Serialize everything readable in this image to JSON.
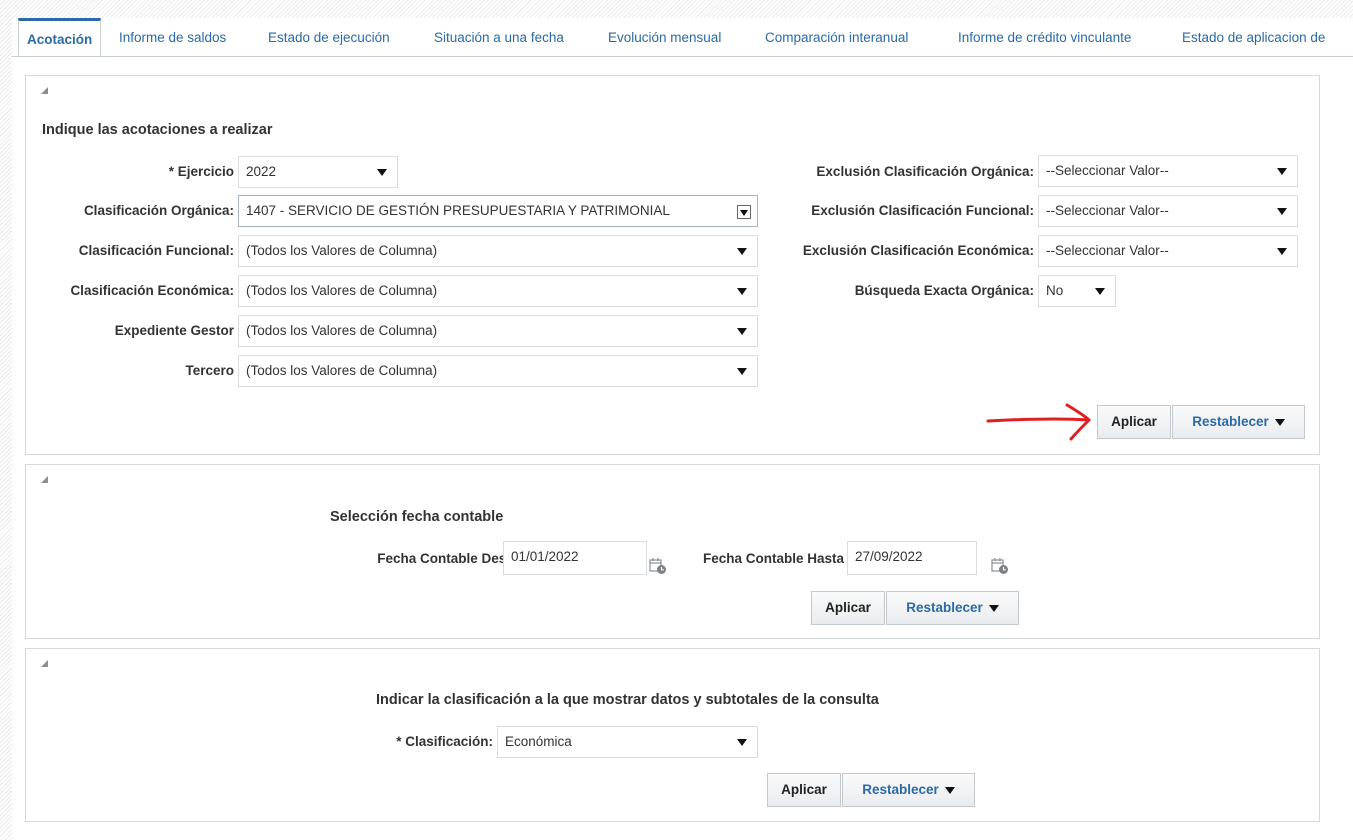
{
  "tabs": [
    {
      "label": "Acotación",
      "active": true
    },
    {
      "label": "Informe de saldos"
    },
    {
      "label": "Estado de ejecución"
    },
    {
      "label": "Situación a una fecha"
    },
    {
      "label": "Evolución mensual"
    },
    {
      "label": "Comparación interanual"
    },
    {
      "label": "Informe de crédito vinculante"
    },
    {
      "label": "Estado de aplicacion de"
    }
  ],
  "panel1": {
    "heading": "Indique las acotaciones a realizar",
    "left_fields": [
      {
        "label": "* Ejercicio",
        "value": "2022"
      },
      {
        "label": "Clasificación Orgánica:",
        "value": "1407 - SERVICIO DE GESTIÓN PRESUPUESTARIA Y PATRIMONIAL"
      },
      {
        "label": "Clasificación Funcional:",
        "value": "(Todos los Valores de Columna)"
      },
      {
        "label": "Clasificación Económica:",
        "value": "(Todos los Valores de Columna)"
      },
      {
        "label": "Expediente Gestor",
        "value": "(Todos los Valores de Columna)"
      },
      {
        "label": "Tercero",
        "value": "(Todos los Valores de Columna)"
      }
    ],
    "right_fields": [
      {
        "label": "Exclusión Clasificación Orgánica:",
        "value": "--Seleccionar Valor--"
      },
      {
        "label": "Exclusión Clasificación Funcional:",
        "value": "--Seleccionar Valor--"
      },
      {
        "label": "Exclusión Clasificación Económica:",
        "value": "--Seleccionar Valor--"
      },
      {
        "label": "Búsqueda Exacta Orgánica:",
        "value": "No"
      }
    ],
    "apply_label": "Aplicar",
    "reset_label": "Restablecer"
  },
  "panel2": {
    "heading": "Selección fecha contable",
    "from_label": "Fecha Contable Desde",
    "from_value": "01/01/2022",
    "to_label": "Fecha Contable Hasta",
    "to_value": "27/09/2022",
    "apply_label": "Aplicar",
    "reset_label": "Restablecer"
  },
  "panel3": {
    "heading": "Indicar la clasificación a la que mostrar datos y subtotales de la consulta",
    "class_label": "* Clasificación:",
    "class_value": "Económica",
    "apply_label": "Aplicar",
    "reset_label": "Restablecer"
  },
  "colors": {
    "link": "#2b6aa6",
    "annotation_arrow": "#e02020"
  },
  "icons": {
    "collapse": "collapse-triangle-icon",
    "dropdown": "dropdown-caret-icon",
    "calendar": "calendar-icon",
    "annotation": "red-arrow-annotation"
  }
}
